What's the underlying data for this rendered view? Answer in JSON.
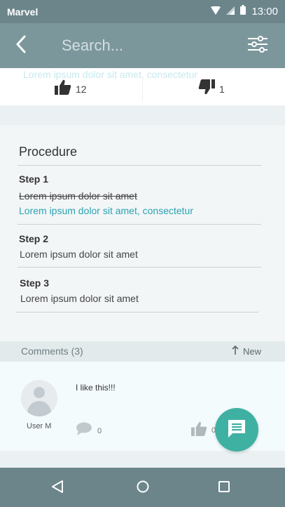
{
  "status_bar": {
    "carrier": "Marvel",
    "time": "13:00",
    "icons": [
      "wifi-icon",
      "signal-icon",
      "battery-icon"
    ]
  },
  "app_bar": {
    "search_placeholder": "Search...",
    "icons": [
      "back-arrow-icon",
      "filter-sliders-icon"
    ]
  },
  "rating": {
    "faded_text": "Lorem ipsum dolor sit amet, consectetur",
    "upvotes": "12",
    "downvotes": "1",
    "icons": [
      "thumbs-up-icon",
      "thumbs-down-icon"
    ]
  },
  "procedure": {
    "title": "Procedure",
    "steps": [
      {
        "title": "Step 1",
        "struck_text": "Lorem ipsum dolor sit amet",
        "link_text": "Lorem ipsum dolor sit amet, consectetur"
      },
      {
        "title": "Step 2",
        "text": "Lorem ipsum dolor sit amet"
      },
      {
        "title": "Step 3",
        "text": "Lorem ipsum dolor sit amet"
      }
    ]
  },
  "comments": {
    "title": "Comments (3)",
    "sort_label": "New",
    "items": [
      {
        "user": "User M",
        "text": "I like this!!!",
        "replies": "0",
        "likes": "0",
        "trailing": "0"
      }
    ]
  },
  "colors": {
    "status_bar": "#6b858b",
    "app_bar": "#7c979c",
    "accent": "#2aa2b3",
    "fab": "#3fb1a3"
  }
}
